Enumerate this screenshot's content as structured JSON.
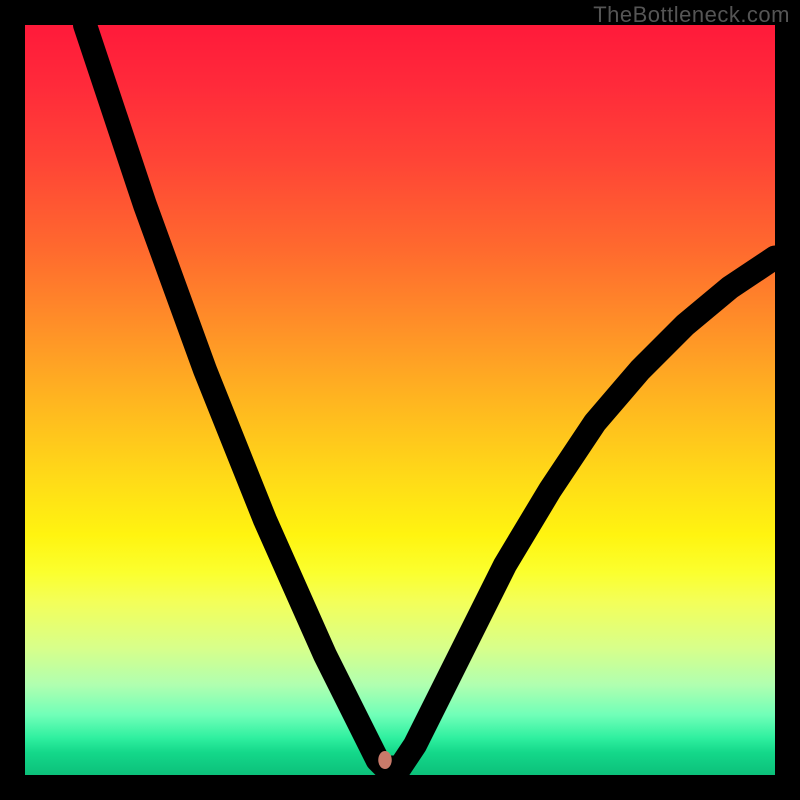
{
  "watermark": "TheBottleneck.com",
  "chart_data": {
    "type": "line",
    "title": "",
    "xlabel": "",
    "ylabel": "",
    "xlim": [
      0,
      100
    ],
    "ylim": [
      0,
      100
    ],
    "grid": false,
    "legend": false,
    "series": [
      {
        "name": "bottleneck-curve",
        "x": [
          8,
          12,
          16,
          20,
          24,
          28,
          32,
          36,
          40,
          42,
          44,
          46,
          47,
          48,
          50,
          52,
          56,
          60,
          64,
          70,
          76,
          82,
          88,
          94,
          100
        ],
        "y": [
          100,
          88,
          76,
          65,
          54,
          44,
          34,
          25,
          16,
          12,
          8,
          4,
          2,
          1,
          1,
          4,
          12,
          20,
          28,
          38,
          47,
          54,
          60,
          65,
          69
        ]
      }
    ],
    "annotations": [
      {
        "name": "optimal-marker",
        "x": 48,
        "y": 2,
        "color": "#c97a6a"
      }
    ],
    "note": "x/y are percentages of the plot area; x left→right, y bottom→top. Values estimated from pixels."
  }
}
